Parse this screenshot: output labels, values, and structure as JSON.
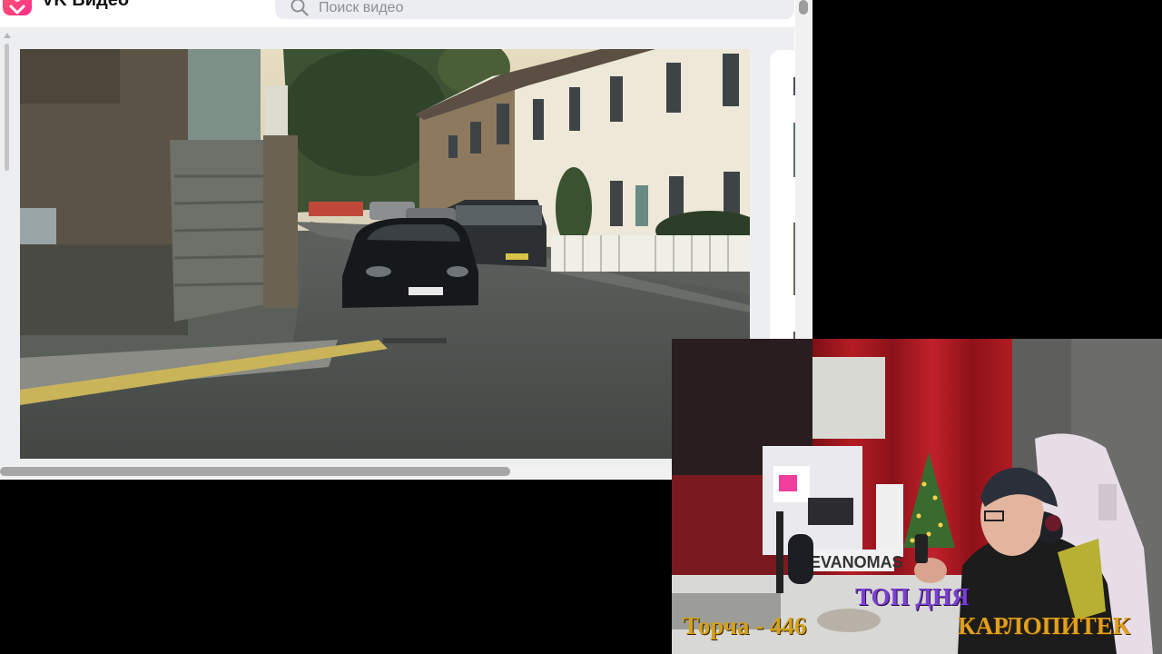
{
  "browser": {
    "brand": "VK Видео",
    "search": {
      "placeholder": "Поиск видео"
    },
    "scroll": {
      "horizontal_fraction": 0.64
    }
  },
  "stream_overlay": {
    "top_day_label": "ТОП ДНЯ",
    "top_day_name": "КАРЛОПИТЕК",
    "counter_text": "Торча - 446",
    "monitor_label": "EVANOMAS"
  },
  "colors": {
    "vk_accent": "#ff3985",
    "top_day_label": "#7a3fd4",
    "top_day_name": "#e0a01e",
    "counter_text": "#d4a21a"
  },
  "icons": {
    "logo": "vk-video-logo-icon",
    "search": "search-icon"
  }
}
